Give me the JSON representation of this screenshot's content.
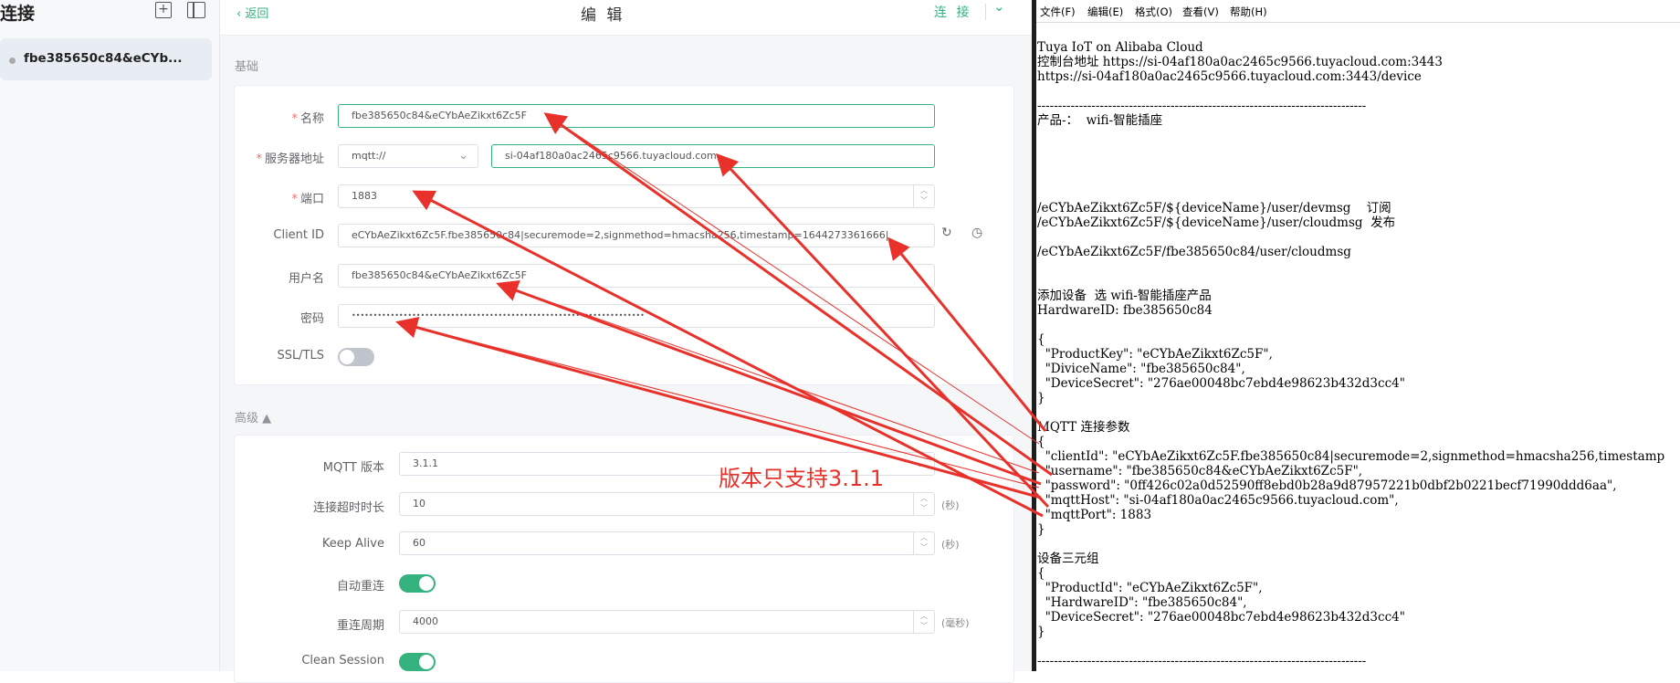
{
  "sidebar": {
    "title": "连接",
    "items": [
      {
        "label": "fbe385650c84&eCYb..."
      }
    ]
  },
  "editor": {
    "back_label": "返回",
    "title": "编 辑",
    "connect_label": "连 接",
    "basic_section": "基础",
    "advanced_section": "高级 ▲",
    "fields": {
      "name": {
        "label": "名称",
        "value": "fbe385650c84&eCYbAeZikxt6Zc5F"
      },
      "server": {
        "label": "服务器地址",
        "protocol": "mqtt://",
        "host": "si-04af180a0ac2465c9566.tuyacloud.com"
      },
      "port": {
        "label": "端口",
        "value": "1883"
      },
      "client_id": {
        "label": "Client ID",
        "value": "eCYbAeZikxt6Zc5F.fbe385650c84|securemode=2,signmethod=hmacsha256,timestamp=1644273361666|"
      },
      "username": {
        "label": "用户名",
        "value": "fbe385650c84&eCYbAeZikxt6Zc5F"
      },
      "password": {
        "label": "密码",
        "value": "••••••••••••••••••••••••••••••••••••••••••••••••••••••••••••••••••••"
      },
      "ssl": {
        "label": "SSL/TLS"
      },
      "mqtt_version": {
        "label": "MQTT 版本",
        "value": "3.1.1"
      },
      "timeout": {
        "label": "连接超时时长",
        "value": "10",
        "unit": "(秒)"
      },
      "keepalive": {
        "label": "Keep Alive",
        "value": "60",
        "unit": "(秒)"
      },
      "auto_reconnect": {
        "label": "自动重连"
      },
      "reconnect_period": {
        "label": "重连周期",
        "value": "4000",
        "unit": "(毫秒)"
      },
      "clean_session": {
        "label": "Clean Session"
      }
    },
    "annotation": "版本只支持3.1.1",
    "arrow_color": "#e8312a"
  },
  "notepad": {
    "menu": [
      "文件(F)",
      "编辑(E)",
      "格式(O)",
      "查看(V)",
      "帮助(H)"
    ],
    "lines": [
      "Tuya IoT on Alibaba Cloud",
      "控制台地址 https://si-04af180a0ac2465c9566.tuyacloud.com:3443",
      "https://si-04af180a0ac2465c9566.tuyacloud.com:3443/device",
      "",
      "-------------------------------------------------------------------------------",
      "产品-：  wifi-智能插座",
      "",
      "",
      "",
      "",
      "",
      "/eCYbAeZikxt6Zc5F/${deviceName}/user/devmsg    订阅",
      "/eCYbAeZikxt6Zc5F/${deviceName}/user/cloudmsg  发布",
      "",
      "/eCYbAeZikxt6Zc5F/fbe385650c84/user/cloudmsg",
      "",
      "",
      "添加设备  选 wifi-智能插座产品",
      "HardwareID: fbe385650c84",
      "",
      "{",
      "  \"ProductKey\": \"eCYbAeZikxt6Zc5F\",",
      "  \"DiviceName\": \"fbe385650c84\",",
      "  \"DeviceSecret\": \"276ae00048bc7ebd4e98623b432d3cc4\"",
      "}",
      "",
      "MQTT 连接参数",
      "{",
      "  \"clientId\": \"eCYbAeZikxt6Zc5F.fbe385650c84|securemode=2,signmethod=hmacsha256,timestamp",
      "  \"username\": \"fbe385650c84&eCYbAeZikxt6Zc5F\",",
      "  \"password\": \"0ff426c02a0d52590ff8ebd0b28a9d87957221b0dbf2b0221becf71990ddd6aa\",",
      "  \"mqttHost\": \"si-04af180a0ac2465c9566.tuyacloud.com\",",
      "  \"mqttPort\": 1883",
      "}",
      "",
      "设备三元组",
      "{",
      "  \"ProductId\": \"eCYbAeZikxt6Zc5F\",",
      "  \"HardwareID\": \"fbe385650c84\",",
      "  \"DeviceSecret\": \"276ae00048bc7ebd4e98623b432d3cc4\"",
      "}",
      "",
      "-------------------------------------------------------------------------------"
    ]
  }
}
